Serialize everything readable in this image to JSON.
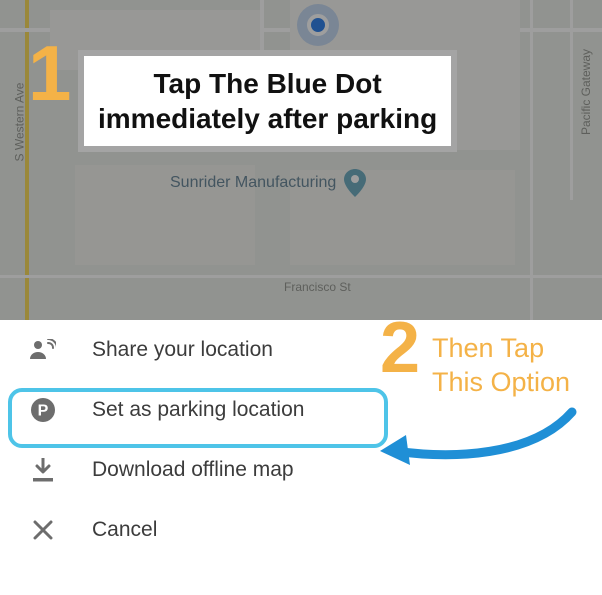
{
  "map": {
    "poi_label": "Sunrider Manufacturing",
    "street_western": "S Western Ave",
    "street_pacific": "Pacific Gateway",
    "street_francisco": "Francisco St"
  },
  "step1": {
    "number": "1",
    "line1": "Tap The Blue Dot",
    "line2": "immediately after parking"
  },
  "step2": {
    "number": "2",
    "line1": "Then Tap",
    "line2": "This Option"
  },
  "menu": {
    "share": "Share your location",
    "parking": "Set as parking location",
    "download": "Download offline map",
    "cancel": "Cancel"
  }
}
